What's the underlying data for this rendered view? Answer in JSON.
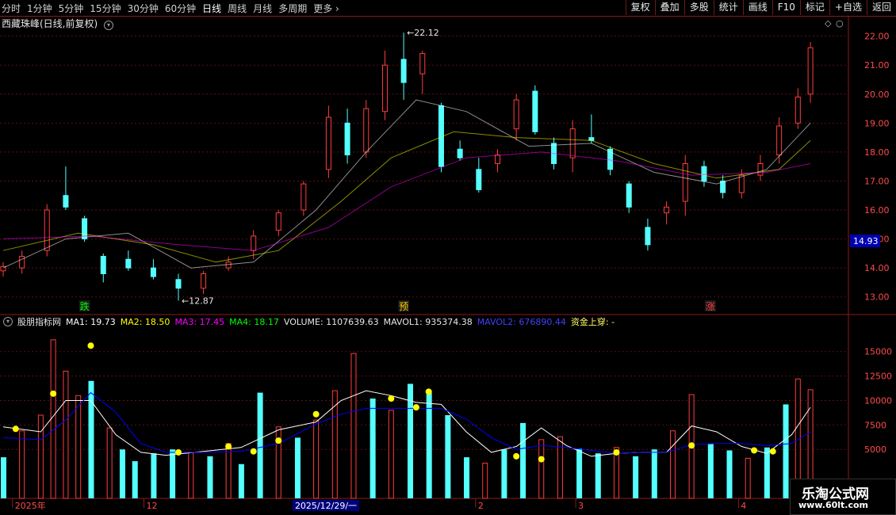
{
  "toolbar": {
    "tabs": [
      "分时",
      "1分钟",
      "5分钟",
      "15分钟",
      "30分钟",
      "60分钟",
      "日线",
      "周线",
      "月线",
      "多周期",
      "更多"
    ],
    "buttons": [
      "复权",
      "叠加",
      "多股",
      "统计",
      "画线",
      "F10",
      "标记",
      "+自选",
      "返回"
    ]
  },
  "header": {
    "title": "西藏珠峰(日线,前复权)"
  },
  "price_axis": {
    "labels": [
      "22.00",
      "21.00",
      "20.00",
      "19.00",
      "18.00",
      "17.00",
      "16.00",
      "15.00",
      "14.00",
      "13.00"
    ],
    "current": "14.93"
  },
  "annotations": {
    "high": "22.12",
    "low": "12.87",
    "markers": [
      "跌",
      "预",
      "涨"
    ]
  },
  "volume_axis": {
    "labels": [
      "15000",
      "12500",
      "10000",
      "7500",
      "5000"
    ]
  },
  "indicator": {
    "name": "股朋指标网",
    "ma1": "MA1: 19.73",
    "ma2": "MA2: 18.50",
    "ma3": "MA3: 17.45",
    "ma4": "MA4: 18.17",
    "volume": "VOLUME: 1107639.63",
    "mavol1": "MAVOL1: 935374.38",
    "mavol2": "MAVOL2: 676890.44",
    "signal": "资金上穿: -"
  },
  "date_axis": {
    "labels": [
      "2025年",
      "12",
      "2025/12/29/一",
      "2",
      "3",
      "4"
    ]
  },
  "watermark": {
    "line1": "乐淘公式网",
    "line2": "www.60lt.com"
  },
  "colors": {
    "up": "#ff3c3c",
    "down": "#54ffff",
    "ma_white": "#ffffff",
    "ma_blue": "#0000ff",
    "dot": "#ffff00"
  },
  "chart_data": {
    "type": "candlestick",
    "candles": [
      {
        "d": 0,
        "o": 13.9,
        "h": 14.2,
        "l": 13.7,
        "c": 14.05
      },
      {
        "d": 3,
        "o": 14.0,
        "h": 14.6,
        "l": 13.8,
        "c": 14.4
      },
      {
        "d": 7,
        "o": 14.6,
        "h": 16.2,
        "l": 14.4,
        "c": 16.0
      },
      {
        "d": 10,
        "o": 16.5,
        "h": 17.5,
        "l": 16.0,
        "c": 16.1
      },
      {
        "d": 13,
        "o": 15.7,
        "h": 15.8,
        "l": 14.9,
        "c": 15.0
      },
      {
        "d": 16,
        "o": 14.4,
        "h": 14.5,
        "l": 13.5,
        "c": 13.8
      },
      {
        "d": 20,
        "o": 14.3,
        "h": 14.6,
        "l": 13.9,
        "c": 14.0
      },
      {
        "d": 24,
        "o": 14.0,
        "h": 14.3,
        "l": 13.6,
        "c": 13.7
      },
      {
        "d": 28,
        "o": 13.6,
        "h": 13.8,
        "l": 12.87,
        "c": 13.3
      },
      {
        "d": 32,
        "o": 13.3,
        "h": 13.9,
        "l": 13.1,
        "c": 13.8
      },
      {
        "d": 36,
        "o": 14.0,
        "h": 14.4,
        "l": 13.9,
        "c": 14.2
      },
      {
        "d": 40,
        "o": 14.6,
        "h": 15.3,
        "l": 14.3,
        "c": 15.1
      },
      {
        "d": 44,
        "o": 15.3,
        "h": 16.0,
        "l": 15.1,
        "c": 15.9
      },
      {
        "d": 48,
        "o": 16.0,
        "h": 17.0,
        "l": 15.8,
        "c": 16.9
      },
      {
        "d": 52,
        "o": 17.4,
        "h": 19.6,
        "l": 17.1,
        "c": 19.2
      },
      {
        "d": 55,
        "o": 19.0,
        "h": 19.5,
        "l": 17.6,
        "c": 17.9
      },
      {
        "d": 58,
        "o": 18.0,
        "h": 19.8,
        "l": 17.8,
        "c": 19.5
      },
      {
        "d": 61,
        "o": 19.4,
        "h": 21.5,
        "l": 19.1,
        "c": 21.0
      },
      {
        "d": 64,
        "o": 21.2,
        "h": 22.12,
        "l": 19.8,
        "c": 20.4
      },
      {
        "d": 67,
        "o": 20.7,
        "h": 21.5,
        "l": 20.0,
        "c": 21.4
      },
      {
        "d": 70,
        "o": 19.6,
        "h": 19.7,
        "l": 17.3,
        "c": 17.5
      },
      {
        "d": 73,
        "o": 18.1,
        "h": 18.4,
        "l": 17.7,
        "c": 17.8
      },
      {
        "d": 76,
        "o": 17.4,
        "h": 17.8,
        "l": 16.6,
        "c": 16.7
      },
      {
        "d": 79,
        "o": 17.6,
        "h": 18.1,
        "l": 17.3,
        "c": 17.9
      },
      {
        "d": 82,
        "o": 18.8,
        "h": 20.0,
        "l": 18.4,
        "c": 19.8
      },
      {
        "d": 85,
        "o": 20.1,
        "h": 20.3,
        "l": 18.6,
        "c": 18.7
      },
      {
        "d": 88,
        "o": 18.3,
        "h": 18.5,
        "l": 17.4,
        "c": 17.6
      },
      {
        "d": 91,
        "o": 17.8,
        "h": 19.1,
        "l": 17.3,
        "c": 18.8
      },
      {
        "d": 94,
        "o": 18.5,
        "h": 19.3,
        "l": 18.3,
        "c": 18.4
      },
      {
        "d": 97,
        "o": 18.1,
        "h": 18.2,
        "l": 17.2,
        "c": 17.4
      },
      {
        "d": 100,
        "o": 16.9,
        "h": 17.0,
        "l": 15.9,
        "c": 16.1
      },
      {
        "d": 103,
        "o": 15.4,
        "h": 15.7,
        "l": 14.6,
        "c": 14.8
      },
      {
        "d": 106,
        "o": 15.9,
        "h": 16.3,
        "l": 15.5,
        "c": 16.1
      },
      {
        "d": 109,
        "o": 16.3,
        "h": 17.9,
        "l": 15.8,
        "c": 17.6
      },
      {
        "d": 112,
        "o": 17.5,
        "h": 17.7,
        "l": 16.8,
        "c": 17.0
      },
      {
        "d": 115,
        "o": 17.0,
        "h": 17.2,
        "l": 16.4,
        "c": 16.6
      },
      {
        "d": 118,
        "o": 16.6,
        "h": 17.4,
        "l": 16.4,
        "c": 17.2
      },
      {
        "d": 121,
        "o": 17.2,
        "h": 17.9,
        "l": 17.0,
        "c": 17.6
      },
      {
        "d": 124,
        "o": 17.9,
        "h": 19.2,
        "l": 17.6,
        "c": 18.9
      },
      {
        "d": 127,
        "o": 19.0,
        "h": 20.2,
        "l": 18.8,
        "c": 19.9
      },
      {
        "d": 129,
        "o": 20.0,
        "h": 21.8,
        "l": 19.7,
        "c": 21.6
      }
    ],
    "volume": [
      {
        "d": 0,
        "v": 4200,
        "up": false
      },
      {
        "d": 3,
        "v": 6900,
        "up": true
      },
      {
        "d": 6,
        "v": 8500,
        "up": true
      },
      {
        "d": 8,
        "v": 16200,
        "up": true
      },
      {
        "d": 10,
        "v": 13000,
        "up": true
      },
      {
        "d": 12,
        "v": 10500,
        "up": true
      },
      {
        "d": 14,
        "v": 12000,
        "up": false
      },
      {
        "d": 17,
        "v": 7200,
        "up": true
      },
      {
        "d": 19,
        "v": 5000,
        "up": false
      },
      {
        "d": 21,
        "v": 3800,
        "up": false
      },
      {
        "d": 24,
        "v": 4600,
        "up": false
      },
      {
        "d": 27,
        "v": 5000,
        "up": false
      },
      {
        "d": 30,
        "v": 4700,
        "up": true
      },
      {
        "d": 33,
        "v": 4300,
        "up": false
      },
      {
        "d": 36,
        "v": 5600,
        "up": true
      },
      {
        "d": 38,
        "v": 3500,
        "up": false
      },
      {
        "d": 41,
        "v": 10800,
        "up": false
      },
      {
        "d": 44,
        "v": 7300,
        "up": true
      },
      {
        "d": 47,
        "v": 6200,
        "up": false
      },
      {
        "d": 50,
        "v": 8000,
        "up": true
      },
      {
        "d": 53,
        "v": 11000,
        "up": true
      },
      {
        "d": 56,
        "v": 14800,
        "up": true
      },
      {
        "d": 59,
        "v": 10200,
        "up": false
      },
      {
        "d": 62,
        "v": 9000,
        "up": true
      },
      {
        "d": 65,
        "v": 11700,
        "up": false
      },
      {
        "d": 68,
        "v": 10800,
        "up": false
      },
      {
        "d": 71,
        "v": 8500,
        "up": false
      },
      {
        "d": 74,
        "v": 4200,
        "up": false
      },
      {
        "d": 77,
        "v": 3600,
        "up": true
      },
      {
        "d": 80,
        "v": 5000,
        "up": false
      },
      {
        "d": 83,
        "v": 7700,
        "up": false
      },
      {
        "d": 86,
        "v": 6000,
        "up": true
      },
      {
        "d": 89,
        "v": 6300,
        "up": true
      },
      {
        "d": 92,
        "v": 5100,
        "up": false
      },
      {
        "d": 95,
        "v": 4600,
        "up": false
      },
      {
        "d": 98,
        "v": 5200,
        "up": true
      },
      {
        "d": 101,
        "v": 4300,
        "up": false
      },
      {
        "d": 104,
        "v": 5000,
        "up": false
      },
      {
        "d": 107,
        "v": 6900,
        "up": true
      },
      {
        "d": 110,
        "v": 10600,
        "up": true
      },
      {
        "d": 113,
        "v": 5600,
        "up": false
      },
      {
        "d": 116,
        "v": 4900,
        "up": false
      },
      {
        "d": 119,
        "v": 4100,
        "up": true
      },
      {
        "d": 122,
        "v": 5200,
        "up": false
      },
      {
        "d": 125,
        "v": 9600,
        "up": false
      },
      {
        "d": 127,
        "v": 12200,
        "up": true
      },
      {
        "d": 129,
        "v": 11100,
        "up": true
      }
    ],
    "vma_white": [
      [
        0,
        7300
      ],
      [
        6,
        6800
      ],
      [
        10,
        10000
      ],
      [
        14,
        10000
      ],
      [
        18,
        6500
      ],
      [
        22,
        4700
      ],
      [
        26,
        4400
      ],
      [
        32,
        4800
      ],
      [
        38,
        5200
      ],
      [
        44,
        7000
      ],
      [
        50,
        7800
      ],
      [
        54,
        10000
      ],
      [
        58,
        11000
      ],
      [
        62,
        10500
      ],
      [
        66,
        9800
      ],
      [
        70,
        9600
      ],
      [
        74,
        6800
      ],
      [
        78,
        4700
      ],
      [
        82,
        5300
      ],
      [
        86,
        7200
      ],
      [
        90,
        5400
      ],
      [
        94,
        4300
      ],
      [
        98,
        4600
      ],
      [
        102,
        4700
      ],
      [
        106,
        4700
      ],
      [
        110,
        7400
      ],
      [
        114,
        6800
      ],
      [
        118,
        5300
      ],
      [
        122,
        4600
      ],
      [
        126,
        6500
      ],
      [
        129,
        9300
      ]
    ],
    "vma_blue": [
      [
        0,
        6200
      ],
      [
        6,
        6000
      ],
      [
        10,
        8000
      ],
      [
        14,
        10800
      ],
      [
        18,
        8800
      ],
      [
        22,
        5600
      ],
      [
        26,
        4700
      ],
      [
        32,
        4700
      ],
      [
        38,
        4800
      ],
      [
        44,
        5600
      ],
      [
        50,
        7600
      ],
      [
        54,
        8600
      ],
      [
        58,
        9200
      ],
      [
        62,
        9200
      ],
      [
        66,
        9200
      ],
      [
        70,
        9200
      ],
      [
        74,
        8100
      ],
      [
        78,
        6200
      ],
      [
        82,
        5000
      ],
      [
        86,
        5400
      ],
      [
        90,
        5200
      ],
      [
        94,
        4900
      ],
      [
        98,
        4600
      ],
      [
        102,
        4700
      ],
      [
        106,
        4700
      ],
      [
        110,
        5500
      ],
      [
        114,
        5600
      ],
      [
        118,
        5600
      ],
      [
        122,
        5400
      ],
      [
        126,
        5600
      ],
      [
        129,
        6800
      ]
    ],
    "signal_dots": [
      [
        2,
        7100
      ],
      [
        8,
        10700
      ],
      [
        14,
        15600
      ],
      [
        28,
        4700
      ],
      [
        36,
        5300
      ],
      [
        40,
        4800
      ],
      [
        44,
        5900
      ],
      [
        50,
        8600
      ],
      [
        62,
        10200
      ],
      [
        66,
        9300
      ],
      [
        68,
        10900
      ],
      [
        82,
        4300
      ],
      [
        86,
        4000
      ],
      [
        98,
        4700
      ],
      [
        110,
        5400
      ],
      [
        120,
        4900
      ],
      [
        123,
        4800
      ]
    ],
    "price_ylim": [
      12.5,
      22.4
    ],
    "volume_ylim": [
      0,
      17000
    ],
    "ma": [
      {
        "color": "#ffffff",
        "pts": [
          [
            0,
            14.0
          ],
          [
            10,
            15.0
          ],
          [
            20,
            15.2
          ],
          [
            30,
            14.0
          ],
          [
            40,
            14.2
          ],
          [
            50,
            16.0
          ],
          [
            58,
            18.0
          ],
          [
            66,
            19.8
          ],
          [
            74,
            19.4
          ],
          [
            84,
            18.2
          ],
          [
            94,
            18.3
          ],
          [
            104,
            17.3
          ],
          [
            114,
            16.9
          ],
          [
            122,
            17.4
          ],
          [
            129,
            19.0
          ]
        ]
      },
      {
        "color": "#ffff00",
        "pts": [
          [
            0,
            14.6
          ],
          [
            12,
            15.2
          ],
          [
            24,
            14.8
          ],
          [
            34,
            14.2
          ],
          [
            44,
            14.6
          ],
          [
            54,
            16.3
          ],
          [
            62,
            17.8
          ],
          [
            72,
            18.7
          ],
          [
            82,
            18.5
          ],
          [
            94,
            18.4
          ],
          [
            104,
            17.6
          ],
          [
            114,
            17.1
          ],
          [
            124,
            17.4
          ],
          [
            129,
            18.4
          ]
        ]
      },
      {
        "color": "#ff00ff",
        "pts": [
          [
            0,
            15.0
          ],
          [
            14,
            15.1
          ],
          [
            28,
            14.8
          ],
          [
            40,
            14.6
          ],
          [
            52,
            15.4
          ],
          [
            62,
            16.8
          ],
          [
            74,
            17.8
          ],
          [
            86,
            18.0
          ],
          [
            98,
            17.7
          ],
          [
            110,
            17.2
          ],
          [
            122,
            17.3
          ],
          [
            129,
            17.6
          ]
        ]
      }
    ]
  }
}
